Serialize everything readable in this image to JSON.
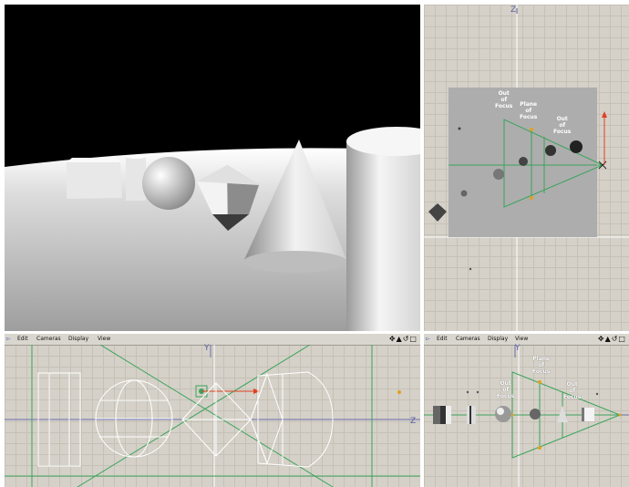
{
  "views": {
    "perspective": {
      "name": "perspective"
    },
    "top": {
      "axis_label": "Z",
      "annotations": {
        "out_focus_left": "Out\nof\nFocus",
        "plane_focus": "Plane\nof\nFocus",
        "out_focus_right": "Out\nof\nFocus"
      }
    },
    "front": {
      "menu": {
        "edit": "Edit",
        "cameras": "Cameras",
        "display": "Display",
        "view": "View"
      },
      "axis_y": "Y",
      "axis_z": "Z"
    },
    "side": {
      "menu": {
        "edit": "Edit",
        "cameras": "Cameras",
        "display": "Display",
        "view": "View"
      },
      "axis_y": "Y",
      "annotations": {
        "out_focus_left": "Out\nof\nFocus",
        "plane_focus": "Plane\nof\nFocus",
        "out_focus_right": "Out\nof\nFocus"
      }
    }
  },
  "colors": {
    "grid_bg": "#d5d1c8",
    "sky": "#000000",
    "floor": "#d8d8d8",
    "camera_green": "#3aa45c",
    "accent_orange": "#e0a020",
    "arrow_red": "#e04020"
  },
  "icons": {
    "menu_tools": "move-zoom-rotate-maximize"
  }
}
